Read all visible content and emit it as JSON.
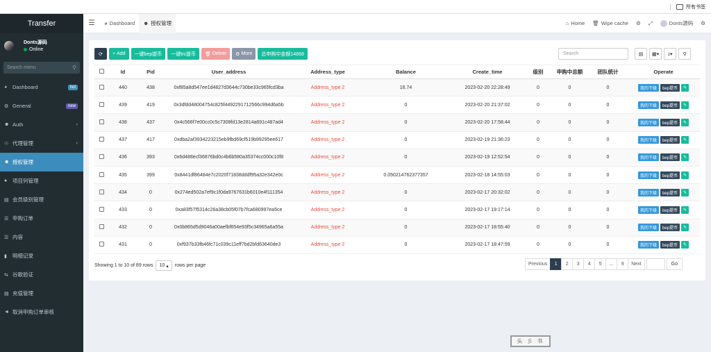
{
  "bookmarks": {
    "label": "所有书签"
  },
  "sidebar": {
    "logo": "Transfer",
    "user": {
      "name": "Donts源码",
      "status": "Online"
    },
    "search_placeholder": "Search menu",
    "items": [
      {
        "label": "Dashboard",
        "badge": "hot",
        "icon": "dashboard-icon"
      },
      {
        "label": "General",
        "badge": "new",
        "icon": "cogs-icon"
      },
      {
        "label": "Auth",
        "chevron": "‹",
        "icon": "users-icon"
      },
      {
        "label": "代理管理",
        "chevron": "‹",
        "icon": "user-circle-icon"
      },
      {
        "label": "授权管理",
        "active": true,
        "icon": "users-icon"
      },
      {
        "label": "项目列管理",
        "icon": "circle-icon"
      },
      {
        "label": "会员级别管理",
        "icon": "calendar-icon"
      },
      {
        "label": "申购订单",
        "icon": "list-icon"
      },
      {
        "label": "内容",
        "icon": "list-icon"
      },
      {
        "label": "明细记录",
        "icon": "bar-chart-icon"
      },
      {
        "label": "谷歌验证",
        "icon": "exchange-icon"
      },
      {
        "label": "充值管理",
        "icon": "calendar-icon"
      },
      {
        "label": "取消申购订单审核",
        "icon": "bullhorn-icon"
      }
    ]
  },
  "topnav": {
    "tabs": [
      {
        "label": "Dashboard",
        "icon": "dashboard-icon"
      },
      {
        "label": "授权管理",
        "icon": "users-icon",
        "active": true
      }
    ],
    "home": "Home",
    "wipe_cache": "Wipe cache",
    "username": "Donts源码"
  },
  "toolbar": {
    "add": "Add",
    "bep": "一键bep提币",
    "trc": "一键trc提币",
    "delete": "Delete",
    "more": "More",
    "total": "总申购中金额14868"
  },
  "search": {
    "placeholder": "Search"
  },
  "table": {
    "columns": [
      "Id",
      "Pid",
      "User_address",
      "Address_type",
      "Balance",
      "Create_time",
      "级别",
      "申购中总额",
      "团队统计",
      "Operate"
    ],
    "op_labels": {
      "downline": "我的下级",
      "bep": "bep提币"
    },
    "rows": [
      {
        "id": "440",
        "pid": "438",
        "address": "0xf85a8d547ee1d4827d3644c730be33c965fcd3ba",
        "type": "Address_type 2",
        "balance": "16.74",
        "time": "2023-02-20 22:28:49",
        "level": "0",
        "total": "0",
        "team": "0"
      },
      {
        "id": "439",
        "pid": "419",
        "address": "0x3dfdd48004754c825f4492291712566c994d6a5b",
        "type": "Address_type 2",
        "balance": "0",
        "time": "2023-02-20 21:37:02",
        "level": "0",
        "total": "0",
        "team": "0"
      },
      {
        "id": "438",
        "pid": "437",
        "address": "0x4c566f7e00cc0c5c7308fd13e2814a691c487ad4",
        "type": "Address_type 2",
        "balance": "0",
        "time": "2023-02-20 17:58:44",
        "level": "0",
        "total": "0",
        "team": "0"
      },
      {
        "id": "437",
        "pid": "417",
        "address": "0xdba2af3934223215eb9fbd69cf519b99295ee617",
        "type": "Address_type 2",
        "balance": "0",
        "time": "2023-02-19 21:36:23",
        "level": "0",
        "total": "0",
        "team": "0"
      },
      {
        "id": "436",
        "pid": "393",
        "address": "0x6d488ecf36876bd0c4b6b580a35374cc000c10f8",
        "type": "Address_type 2",
        "balance": "0",
        "time": "2023-02-19 12:52:54",
        "level": "0",
        "total": "0",
        "team": "0"
      },
      {
        "id": "435",
        "pid": "399",
        "address": "0x8441df86484e7c2020f71838dddf95a32e342e0c",
        "type": "Address_type 2",
        "balance": "0.050214762377357",
        "time": "2023-02-18 14:55:03",
        "level": "0",
        "total": "0",
        "team": "0"
      },
      {
        "id": "434",
        "pid": "0",
        "address": "0x274ed502a7ef9c1f0da9767631b6010e4f111354",
        "type": "Address_type 2",
        "balance": "0",
        "time": "2023-02-17 20:32:02",
        "level": "0",
        "total": "0",
        "team": "0"
      },
      {
        "id": "433",
        "pid": "0",
        "address": "0xa83f57f5314c26a38cb05f07b7fca680997ea5ce",
        "type": "Address_type 2",
        "balance": "0",
        "time": "2023-02-17 19:17:14",
        "level": "0",
        "total": "0",
        "team": "0"
      },
      {
        "id": "432",
        "pid": "0",
        "address": "0x0b865d5d9046a00aefbf654e93f5c34965a6a55a",
        "type": "Address_type 2",
        "balance": "0",
        "time": "2023-02-17 18:55:40",
        "level": "0",
        "total": "0",
        "team": "0"
      },
      {
        "id": "431",
        "pid": "0",
        "address": "0xf937b33fb46fc71c039c11eff7bd2bfd63640de3",
        "type": "Address_type 2",
        "balance": "0",
        "time": "2023-02-17 18:47:59",
        "level": "0",
        "total": "0",
        "team": "0"
      }
    ]
  },
  "footer": {
    "showing": "Showing 1 to 10 of 89 rows",
    "page_size": "10",
    "rows_per_page": "rows per page"
  },
  "pagination": {
    "previous": "Previous",
    "pages": [
      "1",
      "2",
      "3",
      "4",
      "5",
      "...",
      "9"
    ],
    "next": "Next",
    "go": "Go"
  },
  "seal": {
    "text": "头 彡 书"
  }
}
